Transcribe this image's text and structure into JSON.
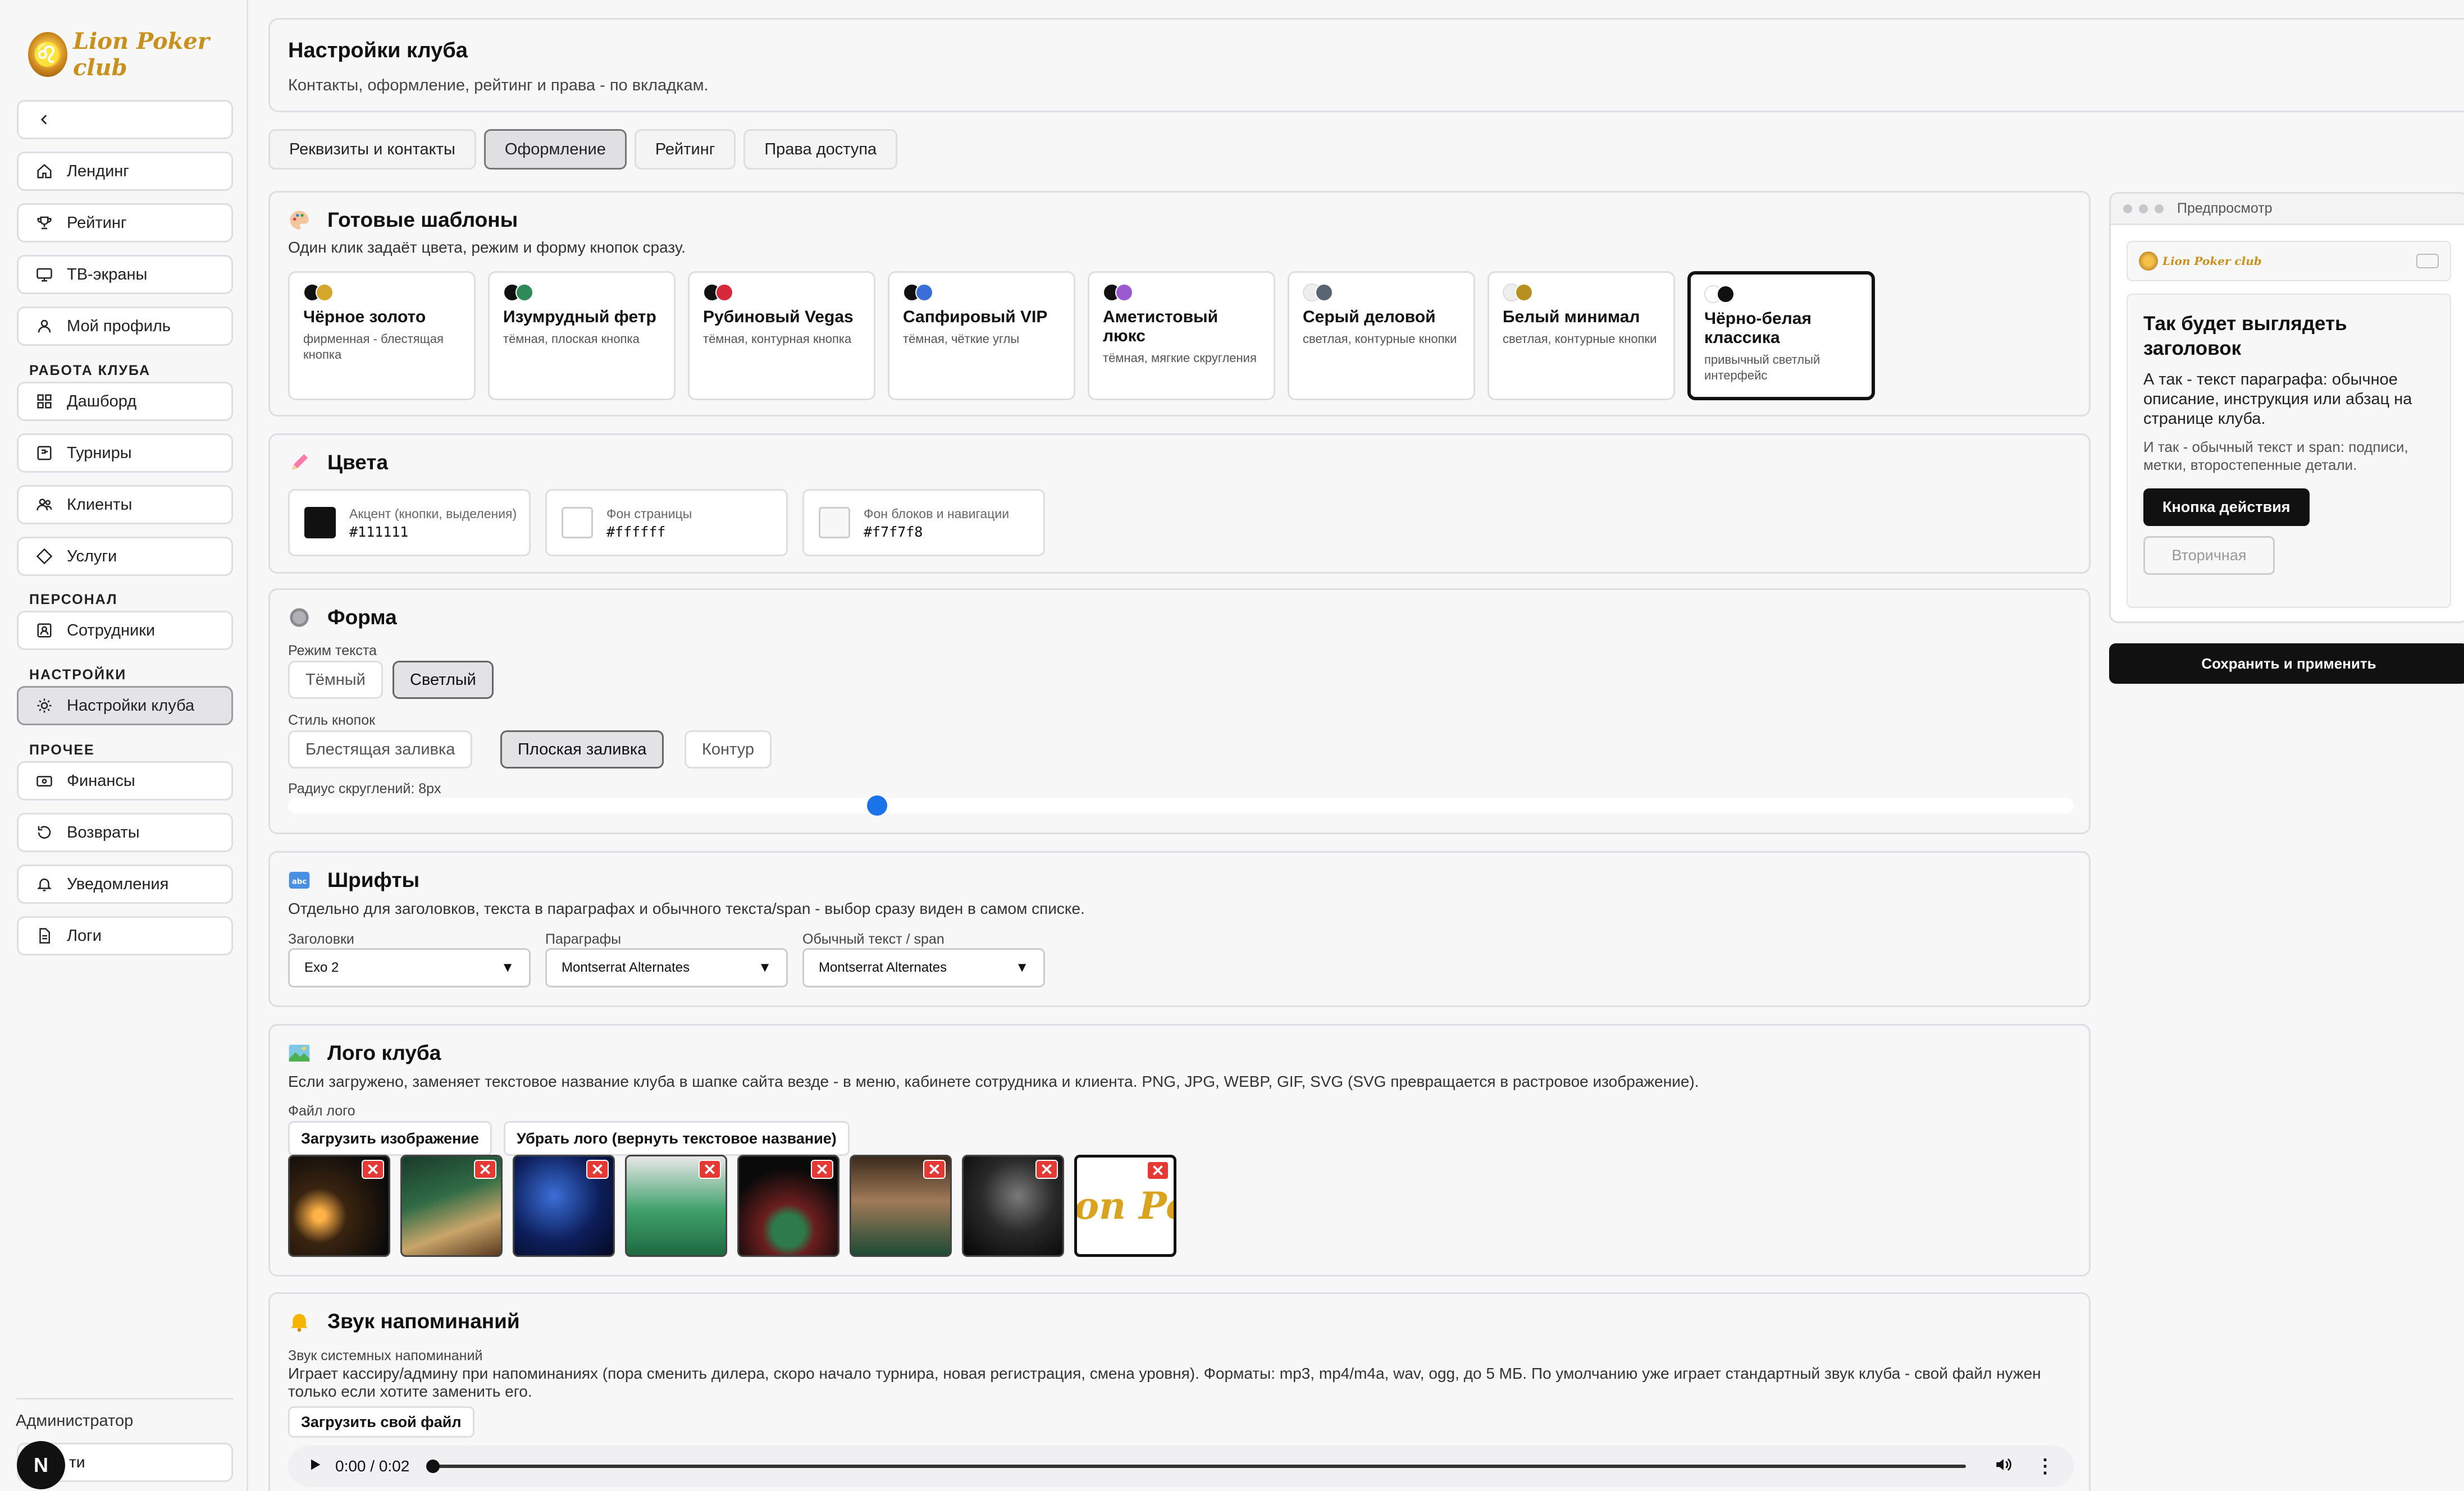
{
  "brand": {
    "logo_text": "Lion Poker club"
  },
  "sidebar": {
    "items_top": [
      {
        "label": "Лендинг"
      },
      {
        "label": "Рейтинг"
      },
      {
        "label": "ТВ-экраны"
      },
      {
        "label": "Мой профиль"
      }
    ],
    "section_work": "РАБОТА КЛУБА",
    "items_work": [
      {
        "label": "Дашборд"
      },
      {
        "label": "Турниры"
      },
      {
        "label": "Клиенты"
      },
      {
        "label": "Услуги"
      }
    ],
    "section_staff": "ПЕРСОНАЛ",
    "items_staff": [
      {
        "label": "Сотрудники"
      }
    ],
    "section_settings": "НАСТРОЙКИ",
    "items_settings": [
      {
        "label": "Настройки клуба"
      }
    ],
    "section_other": "ПРОЧЕЕ",
    "items_other": [
      {
        "label": "Финансы"
      },
      {
        "label": "Возвраты"
      },
      {
        "label": "Уведомления"
      },
      {
        "label": "Логи"
      }
    ],
    "user_role": "Администратор",
    "logout_label": "ти",
    "avatar_letter": "N"
  },
  "header": {
    "title": "Настройки клуба",
    "subtitle": "Контакты, оформление, рейтинг и права - по вкладкам."
  },
  "tabs": [
    {
      "label": "Реквизиты и контакты"
    },
    {
      "label": "Оформление"
    },
    {
      "label": "Рейтинг"
    },
    {
      "label": "Права доступа"
    }
  ],
  "templates": {
    "title": "Готовые шаблоны",
    "subtitle": "Один клик задаёт цвета, режим и форму кнопок сразу.",
    "items": [
      {
        "name": "Чёрное золото",
        "desc": "фирменная - блестящая кнопка",
        "c1": "#111111",
        "c2": "#d4a72c"
      },
      {
        "name": "Изумрудный фетр",
        "desc": "тёмная, плоская кнопка",
        "c1": "#111111",
        "c2": "#2e8b57"
      },
      {
        "name": "Рубиновый Vegas",
        "desc": "тёмная, контурная кнопка",
        "c1": "#111111",
        "c2": "#d62839"
      },
      {
        "name": "Сапфировый VIP",
        "desc": "тёмная, чёткие углы",
        "c1": "#111111",
        "c2": "#3b6fd8"
      },
      {
        "name": "Аметистовый люкс",
        "desc": "тёмная, мягкие скругления",
        "c1": "#111111",
        "c2": "#9b59d0"
      },
      {
        "name": "Серый деловой",
        "desc": "светлая, контурные кнопки",
        "c1": "#eeeeee",
        "c2": "#5a6472"
      },
      {
        "name": "Белый минимал",
        "desc": "светлая, контурные кнопки",
        "c1": "#eeeeee",
        "c2": "#b8901f"
      },
      {
        "name": "Чёрно-белая классика",
        "desc": "привычный светлый интерфейс",
        "c1": "#ffffff",
        "c2": "#111111"
      }
    ]
  },
  "colors": {
    "title": "Цвета",
    "items": [
      {
        "label": "Акцент (кнопки, выделения)",
        "value": "#111111"
      },
      {
        "label": "Фон страницы",
        "value": "#ffffff"
      },
      {
        "label": "Фон блоков и навигации",
        "value": "#f7f7f8"
      }
    ]
  },
  "form": {
    "title": "Форма",
    "text_mode_label": "Режим текста",
    "text_modes": [
      "Тёмный",
      "Светлый"
    ],
    "button_style_label": "Стиль кнопок",
    "button_styles": [
      "Блестящая заливка",
      "Плоская заливка",
      "Контур"
    ],
    "radius_label": "Радиус скруглений: 8px",
    "radius_fraction": 0.33
  },
  "fonts": {
    "title": "Шрифты",
    "subtitle": "Отдельно для заголовков, текста в параграфах и обычного текста/span - выбор сразу виден в самом списке.",
    "fields": [
      {
        "label": "Заголовки",
        "value": "Exo 2"
      },
      {
        "label": "Параграфы",
        "value": "Montserrat Alternates"
      },
      {
        "label": "Обычный текст / span",
        "value": "Montserrat Alternates"
      }
    ]
  },
  "logo": {
    "title": "Лого клуба",
    "subtitle": "Если загружено, заменяет текстовое название клуба в шапке сайта везде - в меню, кабинете сотрудника и клиента. PNG, JPG, WEBP, GIF, SVG (SVG превращается в растровое изображение).",
    "file_label": "Файл лого",
    "upload_label": "Загрузить изображение",
    "remove_label": "Убрать лого (вернуть текстовое название)",
    "thumb_text": "ion Po"
  },
  "sound": {
    "title": "Звук напоминаний",
    "label": "Звук системных напоминаний",
    "desc": "Играет кассиру/админу при напоминаниях (пора сменить дилера, скоро начало турнира, новая регистрация, смена уровня). Форматы: mp3, mp4/m4a, wav, ogg, до 5 МБ. По умолчанию уже играет стандартный звук клуба - свой файл нужен только если хотите заменить его.",
    "upload_label": "Загрузить свой файл",
    "time": "0:00 / 0:02"
  },
  "preview": {
    "bar_label": "Предпросмотр",
    "heading": "Так будет выглядеть заголовок",
    "paragraph": "А так - текст параграфа: обычное описание, инструкция или абзац на странице клуба.",
    "span": "И так - обычный текст и span: подписи, метки, второстепенные детали.",
    "primary": "Кнопка действия",
    "secondary": "Вторичная"
  },
  "save_label": "Сохранить и применить"
}
